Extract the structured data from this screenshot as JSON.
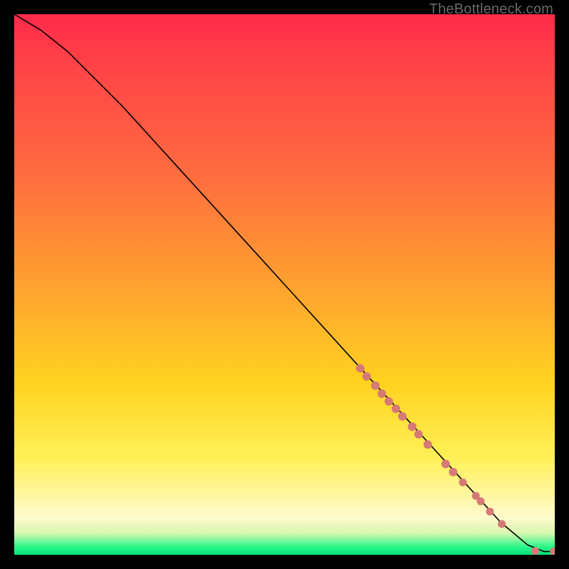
{
  "attribution": "TheBottleneck.com",
  "colors": {
    "dot": "#d67a76",
    "curve": "#000000",
    "frame": "#000000"
  },
  "chart_data": {
    "type": "line",
    "title": "",
    "xlabel": "",
    "ylabel": "",
    "xlim": [
      0,
      100
    ],
    "ylim": [
      0,
      100
    ],
    "grid": false,
    "legend": false,
    "series": [
      {
        "name": "curve",
        "x": [
          0,
          5,
          10,
          15,
          20,
          25,
          30,
          35,
          40,
          45,
          50,
          55,
          60,
          65,
          70,
          75,
          80,
          85,
          90,
          95,
          98,
          100
        ],
        "y": [
          100,
          97,
          93,
          88,
          83,
          77.5,
          72,
          66.5,
          61,
          55.5,
          50,
          44.5,
          39,
          33.5,
          28,
          22.5,
          17,
          11.5,
          6,
          1.8,
          0.6,
          0.6
        ]
      }
    ],
    "markers": [
      {
        "x": 64.0,
        "y": 34.5,
        "r": 6
      },
      {
        "x": 65.2,
        "y": 33.0,
        "r": 6
      },
      {
        "x": 66.8,
        "y": 31.3,
        "r": 6
      },
      {
        "x": 68.0,
        "y": 29.8,
        "r": 6
      },
      {
        "x": 69.3,
        "y": 28.4,
        "r": 6
      },
      {
        "x": 70.6,
        "y": 27.0,
        "r": 6
      },
      {
        "x": 71.8,
        "y": 25.6,
        "r": 6
      },
      {
        "x": 73.6,
        "y": 23.7,
        "r": 6
      },
      {
        "x": 74.8,
        "y": 22.3,
        "r": 6
      },
      {
        "x": 76.5,
        "y": 20.4,
        "r": 6
      },
      {
        "x": 79.8,
        "y": 16.8,
        "r": 6
      },
      {
        "x": 81.2,
        "y": 15.3,
        "r": 6
      },
      {
        "x": 83.0,
        "y": 13.4,
        "r": 5.5
      },
      {
        "x": 85.4,
        "y": 10.9,
        "r": 5.5
      },
      {
        "x": 86.3,
        "y": 9.9,
        "r": 5.5
      },
      {
        "x": 88.0,
        "y": 8.0,
        "r": 5.5
      },
      {
        "x": 90.2,
        "y": 5.7,
        "r": 5.5
      },
      {
        "x": 96.4,
        "y": 0.7,
        "r": 5.5
      },
      {
        "x": 99.8,
        "y": 0.6,
        "r": 5.5
      }
    ]
  }
}
